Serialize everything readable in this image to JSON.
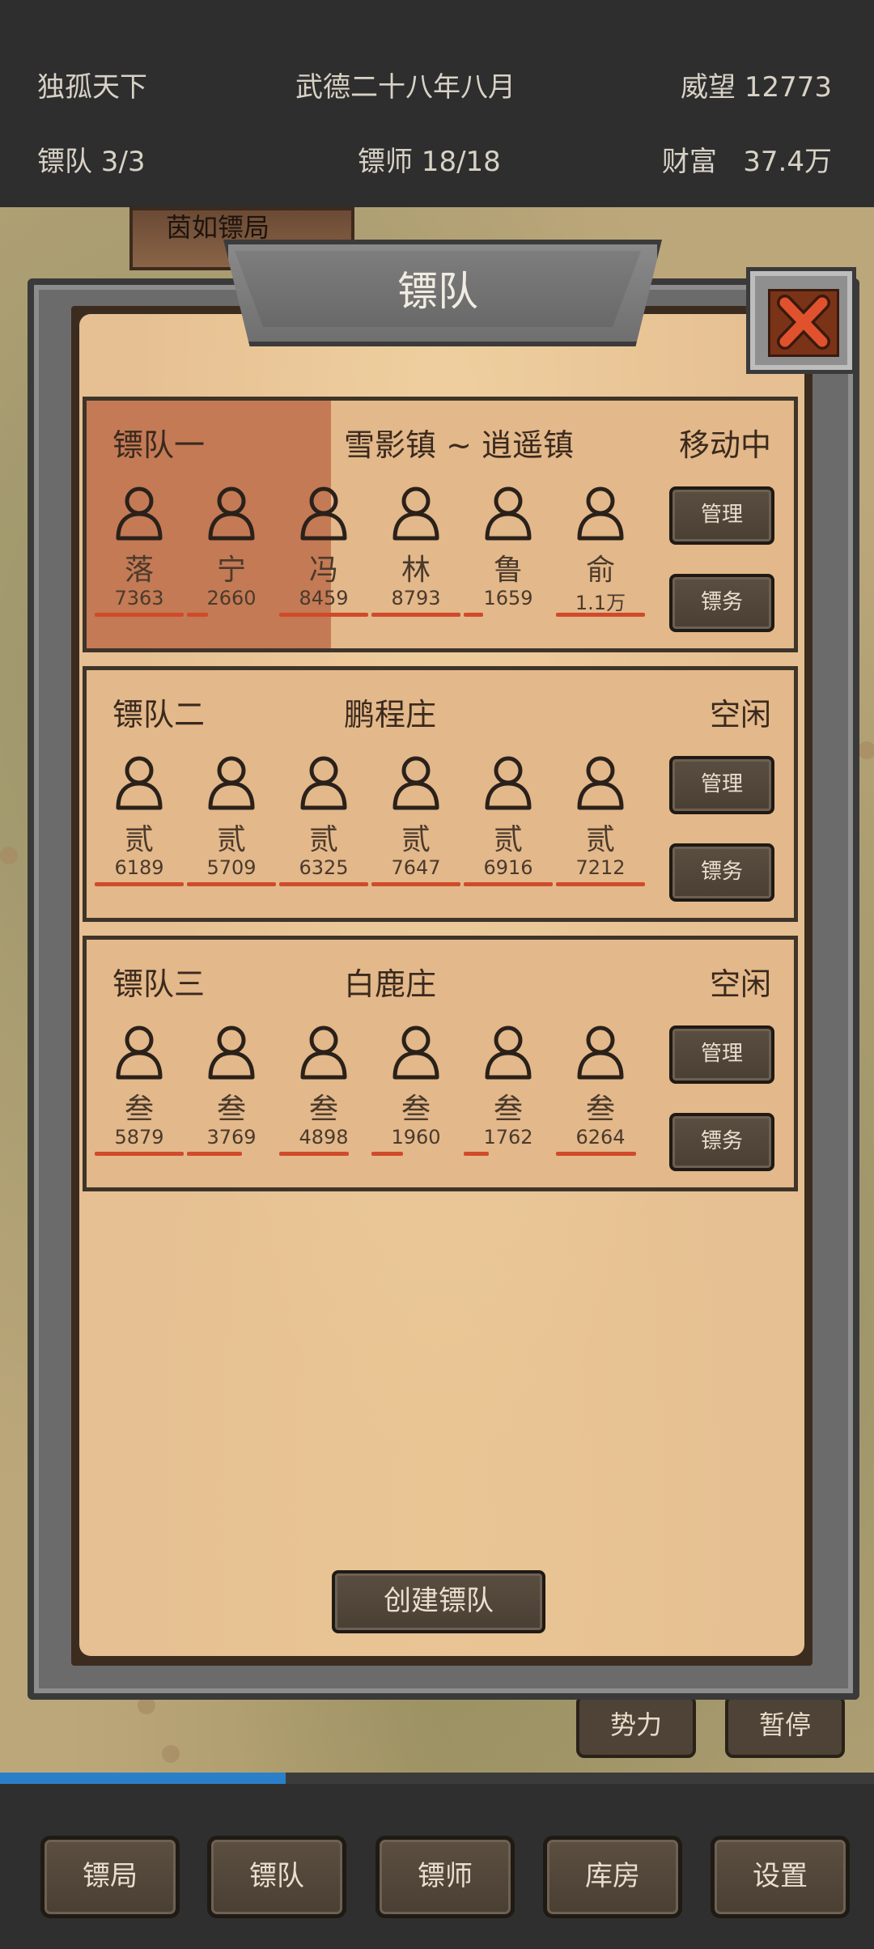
{
  "status": {
    "player": "独孤天下",
    "date": "武德二十八年八月",
    "prestige": "威望 12773",
    "teams": "镖队 3/3",
    "escorts": "镖师 18/18",
    "wealth": "财富   37.4万"
  },
  "map": {
    "city_label": "茵如镖局",
    "btn_power": "势力",
    "btn_pause": "暂停"
  },
  "progress": {
    "fraction": 0.327
  },
  "dialog": {
    "title": "镖队",
    "manage_label": "管理",
    "task_label": "镖务",
    "create_label": "创建镖队"
  },
  "teams": [
    {
      "name": "镖队一",
      "location": "雪影镇 ~ 逍遥镇",
      "status": "移动中",
      "highlight": true,
      "members": [
        {
          "name": "落",
          "value": "7363",
          "bar": 1.0
        },
        {
          "name": "宁",
          "value": "2660",
          "bar": 0.24
        },
        {
          "name": "冯",
          "value": "8459",
          "bar": 1.0
        },
        {
          "name": "林",
          "value": "8793",
          "bar": 1.0
        },
        {
          "name": "鲁",
          "value": "1659",
          "bar": 0.22
        },
        {
          "name": "俞",
          "value": "1.1万",
          "bar": 1.0
        }
      ]
    },
    {
      "name": "镖队二",
      "location": "鹏程庄",
      "status": "空闲",
      "highlight": false,
      "members": [
        {
          "name": "贰",
          "value": "6189",
          "bar": 1.0
        },
        {
          "name": "贰",
          "value": "5709",
          "bar": 1.0
        },
        {
          "name": "贰",
          "value": "6325",
          "bar": 1.0
        },
        {
          "name": "贰",
          "value": "7647",
          "bar": 1.0
        },
        {
          "name": "贰",
          "value": "6916",
          "bar": 1.0
        },
        {
          "name": "贰",
          "value": "7212",
          "bar": 1.0
        }
      ]
    },
    {
      "name": "镖队三",
      "location": "白鹿庄",
      "status": "空闲",
      "highlight": false,
      "members": [
        {
          "name": "叁",
          "value": "5879",
          "bar": 1.0
        },
        {
          "name": "叁",
          "value": "3769",
          "bar": 0.62
        },
        {
          "name": "叁",
          "value": "4898",
          "bar": 0.78
        },
        {
          "name": "叁",
          "value": "1960",
          "bar": 0.35
        },
        {
          "name": "叁",
          "value": "1762",
          "bar": 0.28
        },
        {
          "name": "叁",
          "value": "6264",
          "bar": 0.9
        }
      ]
    }
  ],
  "nav": [
    "镖局",
    "镖队",
    "镖师",
    "库房",
    "设置"
  ],
  "colors": {
    "accent_bar": "#d04a2c",
    "progress": "#2a80c8",
    "highlight": "#c47a55"
  }
}
